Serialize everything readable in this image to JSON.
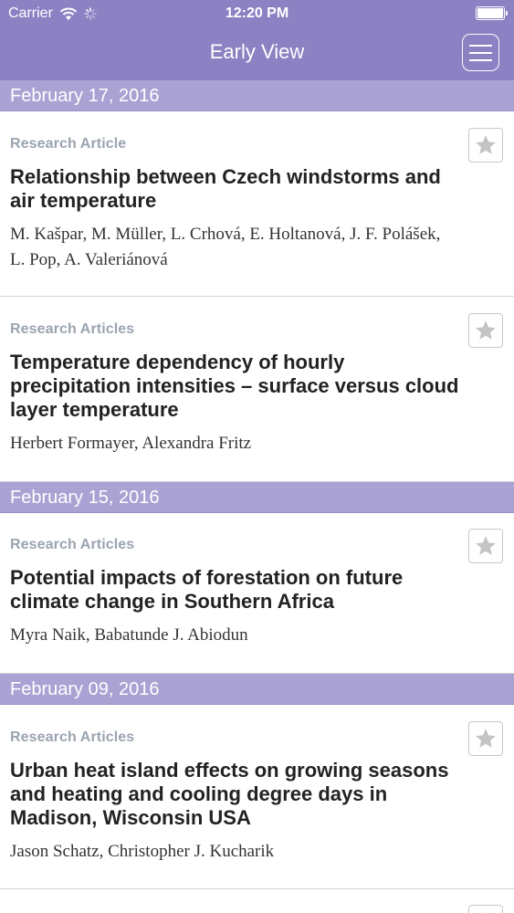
{
  "status_bar": {
    "carrier": "Carrier",
    "time": "12:20 PM"
  },
  "nav": {
    "title": "Early View",
    "menu_icon": "hamburger-menu-icon"
  },
  "colors": {
    "nav_background": "#8c81c3",
    "date_header_background": "#a9a2d3",
    "article_type_text": "#9ba4b0"
  },
  "sections": [
    {
      "date": "February 17, 2016",
      "articles": [
        {
          "type": "Research Article",
          "title": "Relationship between Czech windstorms and air temperature",
          "authors": "M. Kašpar, M. Müller, L. Crhová, E. Holtanová, J. F. Polášek, L. Pop, A. Valeriánová"
        },
        {
          "type": "Research Articles",
          "title": "Temperature dependency of hourly precipitation intensities – surface versus cloud layer temperature",
          "authors": "Herbert Formayer, Alexandra Fritz"
        }
      ]
    },
    {
      "date": "February 15, 2016",
      "articles": [
        {
          "type": "Research Articles",
          "title": "Potential impacts of forestation on future climate change in Southern Africa",
          "authors": "Myra Naik, Babatunde J. Abiodun"
        }
      ]
    },
    {
      "date": "February 09, 2016",
      "articles": [
        {
          "type": "Research Articles",
          "title": "Urban heat island effects on growing seasons and heating and cooling degree days in Madison, Wisconsin USA",
          "authors": "Jason Schatz, Christopher J. Kucharik"
        }
      ]
    }
  ]
}
